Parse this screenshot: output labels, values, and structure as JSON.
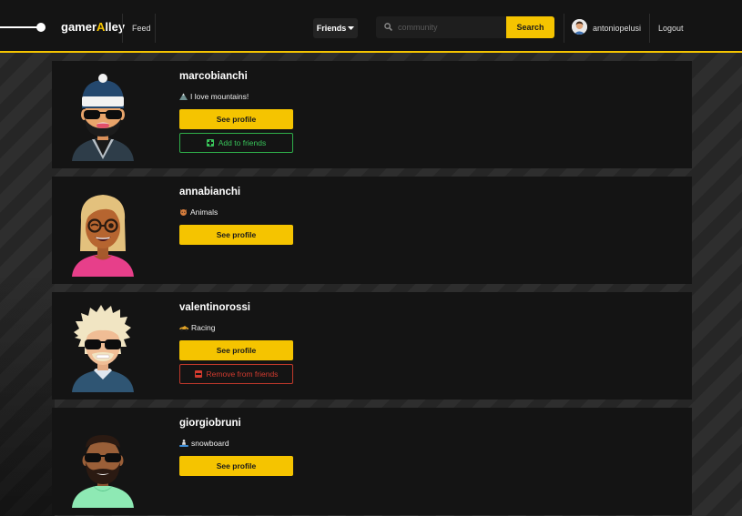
{
  "navbar": {
    "brand_prefix": "gamer",
    "brand_accent": "A",
    "brand_suffix": "lley",
    "feed_label": "Feed",
    "friends_label": "Friends",
    "search_placeholder": "community",
    "search_label": "Search",
    "username": "antoniopelusi",
    "logout_label": "Logout"
  },
  "colors": {
    "accent": "#f5c400",
    "add": "#39c45a",
    "remove": "#d23b2f"
  },
  "users": [
    {
      "username": "marcobianchi",
      "bio_icon": "mountain-icon",
      "bio": "I love mountains!",
      "profile_label": "See profile",
      "action_label": "Add to friends"
    },
    {
      "username": "annabianchi",
      "bio_icon": "animal-icon",
      "bio": "Animals",
      "profile_label": "See profile"
    },
    {
      "username": "valentinorossi",
      "bio_icon": "race-car-icon",
      "bio": "Racing",
      "profile_label": "See profile",
      "action_label": "Remove from friends"
    },
    {
      "username": "giorgiobruni",
      "bio_icon": "snowboard-icon",
      "bio": "snowboard",
      "profile_label": "See profile"
    }
  ]
}
